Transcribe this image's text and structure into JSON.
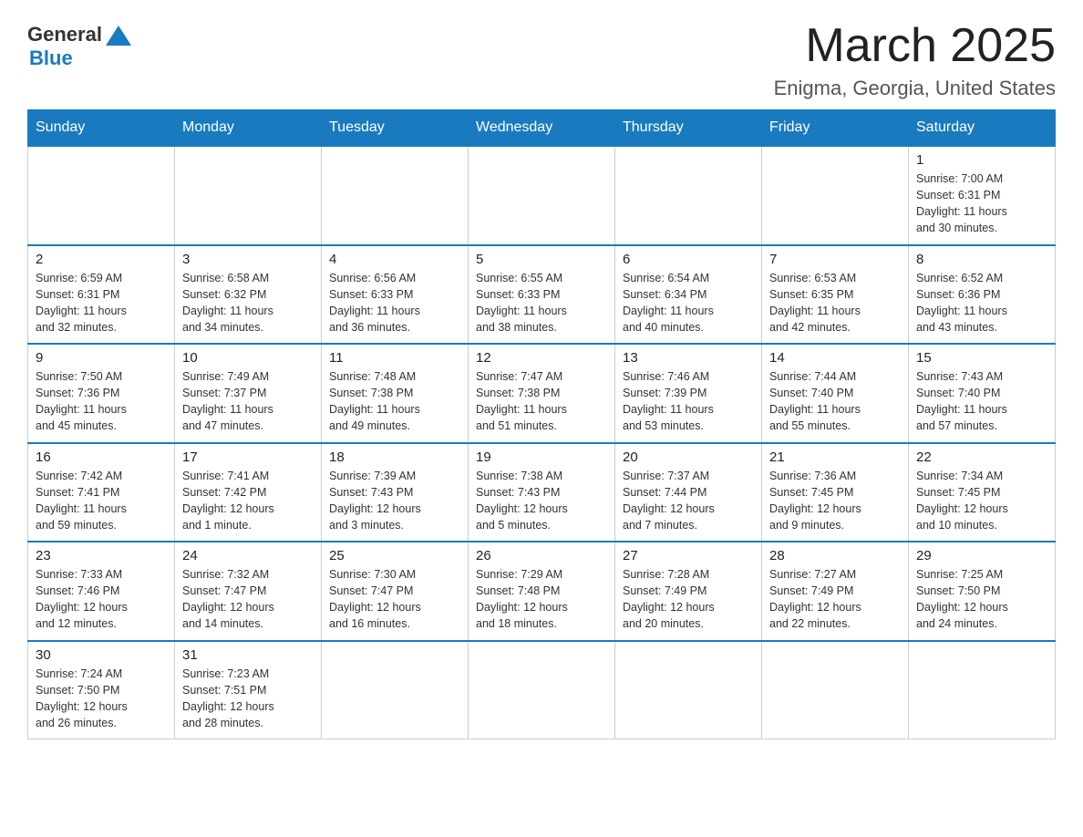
{
  "header": {
    "logo": {
      "general": "General",
      "blue": "Blue"
    },
    "title": "March 2025",
    "location": "Enigma, Georgia, United States"
  },
  "weekdays": [
    "Sunday",
    "Monday",
    "Tuesday",
    "Wednesday",
    "Thursday",
    "Friday",
    "Saturday"
  ],
  "weeks": [
    [
      {
        "day": "",
        "info": ""
      },
      {
        "day": "",
        "info": ""
      },
      {
        "day": "",
        "info": ""
      },
      {
        "day": "",
        "info": ""
      },
      {
        "day": "",
        "info": ""
      },
      {
        "day": "",
        "info": ""
      },
      {
        "day": "1",
        "info": "Sunrise: 7:00 AM\nSunset: 6:31 PM\nDaylight: 11 hours\nand 30 minutes."
      }
    ],
    [
      {
        "day": "2",
        "info": "Sunrise: 6:59 AM\nSunset: 6:31 PM\nDaylight: 11 hours\nand 32 minutes."
      },
      {
        "day": "3",
        "info": "Sunrise: 6:58 AM\nSunset: 6:32 PM\nDaylight: 11 hours\nand 34 minutes."
      },
      {
        "day": "4",
        "info": "Sunrise: 6:56 AM\nSunset: 6:33 PM\nDaylight: 11 hours\nand 36 minutes."
      },
      {
        "day": "5",
        "info": "Sunrise: 6:55 AM\nSunset: 6:33 PM\nDaylight: 11 hours\nand 38 minutes."
      },
      {
        "day": "6",
        "info": "Sunrise: 6:54 AM\nSunset: 6:34 PM\nDaylight: 11 hours\nand 40 minutes."
      },
      {
        "day": "7",
        "info": "Sunrise: 6:53 AM\nSunset: 6:35 PM\nDaylight: 11 hours\nand 42 minutes."
      },
      {
        "day": "8",
        "info": "Sunrise: 6:52 AM\nSunset: 6:36 PM\nDaylight: 11 hours\nand 43 minutes."
      }
    ],
    [
      {
        "day": "9",
        "info": "Sunrise: 7:50 AM\nSunset: 7:36 PM\nDaylight: 11 hours\nand 45 minutes."
      },
      {
        "day": "10",
        "info": "Sunrise: 7:49 AM\nSunset: 7:37 PM\nDaylight: 11 hours\nand 47 minutes."
      },
      {
        "day": "11",
        "info": "Sunrise: 7:48 AM\nSunset: 7:38 PM\nDaylight: 11 hours\nand 49 minutes."
      },
      {
        "day": "12",
        "info": "Sunrise: 7:47 AM\nSunset: 7:38 PM\nDaylight: 11 hours\nand 51 minutes."
      },
      {
        "day": "13",
        "info": "Sunrise: 7:46 AM\nSunset: 7:39 PM\nDaylight: 11 hours\nand 53 minutes."
      },
      {
        "day": "14",
        "info": "Sunrise: 7:44 AM\nSunset: 7:40 PM\nDaylight: 11 hours\nand 55 minutes."
      },
      {
        "day": "15",
        "info": "Sunrise: 7:43 AM\nSunset: 7:40 PM\nDaylight: 11 hours\nand 57 minutes."
      }
    ],
    [
      {
        "day": "16",
        "info": "Sunrise: 7:42 AM\nSunset: 7:41 PM\nDaylight: 11 hours\nand 59 minutes."
      },
      {
        "day": "17",
        "info": "Sunrise: 7:41 AM\nSunset: 7:42 PM\nDaylight: 12 hours\nand 1 minute."
      },
      {
        "day": "18",
        "info": "Sunrise: 7:39 AM\nSunset: 7:43 PM\nDaylight: 12 hours\nand 3 minutes."
      },
      {
        "day": "19",
        "info": "Sunrise: 7:38 AM\nSunset: 7:43 PM\nDaylight: 12 hours\nand 5 minutes."
      },
      {
        "day": "20",
        "info": "Sunrise: 7:37 AM\nSunset: 7:44 PM\nDaylight: 12 hours\nand 7 minutes."
      },
      {
        "day": "21",
        "info": "Sunrise: 7:36 AM\nSunset: 7:45 PM\nDaylight: 12 hours\nand 9 minutes."
      },
      {
        "day": "22",
        "info": "Sunrise: 7:34 AM\nSunset: 7:45 PM\nDaylight: 12 hours\nand 10 minutes."
      }
    ],
    [
      {
        "day": "23",
        "info": "Sunrise: 7:33 AM\nSunset: 7:46 PM\nDaylight: 12 hours\nand 12 minutes."
      },
      {
        "day": "24",
        "info": "Sunrise: 7:32 AM\nSunset: 7:47 PM\nDaylight: 12 hours\nand 14 minutes."
      },
      {
        "day": "25",
        "info": "Sunrise: 7:30 AM\nSunset: 7:47 PM\nDaylight: 12 hours\nand 16 minutes."
      },
      {
        "day": "26",
        "info": "Sunrise: 7:29 AM\nSunset: 7:48 PM\nDaylight: 12 hours\nand 18 minutes."
      },
      {
        "day": "27",
        "info": "Sunrise: 7:28 AM\nSunset: 7:49 PM\nDaylight: 12 hours\nand 20 minutes."
      },
      {
        "day": "28",
        "info": "Sunrise: 7:27 AM\nSunset: 7:49 PM\nDaylight: 12 hours\nand 22 minutes."
      },
      {
        "day": "29",
        "info": "Sunrise: 7:25 AM\nSunset: 7:50 PM\nDaylight: 12 hours\nand 24 minutes."
      }
    ],
    [
      {
        "day": "30",
        "info": "Sunrise: 7:24 AM\nSunset: 7:50 PM\nDaylight: 12 hours\nand 26 minutes."
      },
      {
        "day": "31",
        "info": "Sunrise: 7:23 AM\nSunset: 7:51 PM\nDaylight: 12 hours\nand 28 minutes."
      },
      {
        "day": "",
        "info": ""
      },
      {
        "day": "",
        "info": ""
      },
      {
        "day": "",
        "info": ""
      },
      {
        "day": "",
        "info": ""
      },
      {
        "day": "",
        "info": ""
      }
    ]
  ]
}
